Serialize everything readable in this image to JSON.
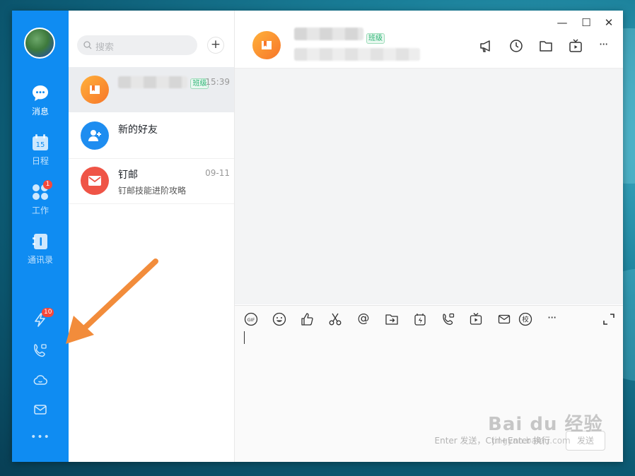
{
  "colors": {
    "nav_bg": "#0f8cf2",
    "badge": "#f5483b",
    "accent_tag": "#2bb373",
    "arrow": "#f28c3b"
  },
  "nav": {
    "items": [
      {
        "label": "消息",
        "icon": "chat-bubble-icon"
      },
      {
        "label": "日程",
        "icon": "calendar-icon",
        "icon_text": "15"
      },
      {
        "label": "工作",
        "icon": "apps-grid-icon",
        "badge": "1"
      },
      {
        "label": "通讯录",
        "icon": "contacts-book-icon"
      }
    ],
    "bottom": [
      {
        "icon": "ding-lightning-icon",
        "badge": "10"
      },
      {
        "icon": "video-call-icon"
      },
      {
        "icon": "cloud-icon"
      },
      {
        "icon": "mail-icon"
      },
      {
        "icon": "more-dots-icon",
        "label": "•••"
      }
    ]
  },
  "search": {
    "placeholder": "搜索",
    "add_label": "+"
  },
  "conversations": [
    {
      "title": "",
      "tag": "班级",
      "time": "15:39",
      "subtitle": ""
    },
    {
      "title": "新的好友",
      "time": "",
      "subtitle": ""
    },
    {
      "title": "钉邮",
      "time": "09-11",
      "subtitle": "钉邮技能进阶攻略"
    }
  ],
  "chat": {
    "header_tag": "班级",
    "window_controls": {
      "minimize": "—",
      "maximize": "☐",
      "close": "✕"
    },
    "top_tools": [
      "announcement-icon",
      "history-clock-icon",
      "folder-icon",
      "live-tv-icon",
      "more-icon"
    ],
    "more_label": "···",
    "toolbar": [
      "gif-icon",
      "emoji-icon",
      "thumbs-up-icon",
      "scissors-icon",
      "at-icon",
      "file-transfer-icon",
      "ding-icon",
      "call-icon",
      "live-icon",
      "mail-icon",
      "school-icon",
      "more-icon",
      "expand-icon"
    ],
    "gif_label": "GIF",
    "school_label": "校",
    "at_label": "@",
    "input_hint": "Enter 发送，Ctrl+Enter 换行",
    "send_label": "发送"
  },
  "watermark": {
    "brand": "Bai du 经验",
    "url": "jingyan.baidu.com"
  }
}
